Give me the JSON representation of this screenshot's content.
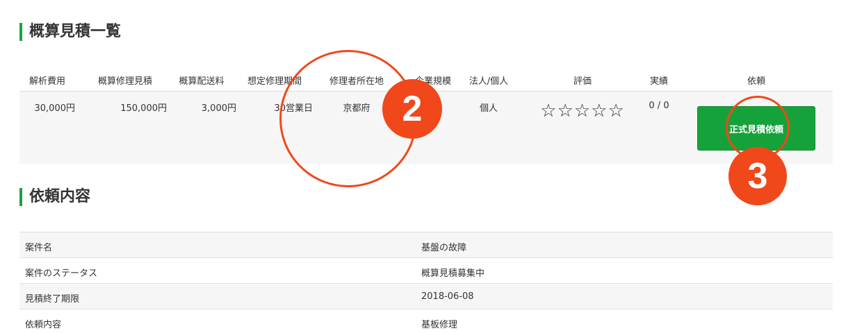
{
  "estimate_section": {
    "title": "概算見積一覧",
    "headers": [
      "解析費用",
      "概算修理見積",
      "概算配送料",
      "想定修理期間",
      "修理者所在地",
      "企業規模",
      "法人/個人",
      "評価",
      "実績",
      "依頼"
    ],
    "row": {
      "analysis_fee": "30,000円",
      "repair_estimate": "150,000円",
      "shipping_fee": "3,000円",
      "repair_period": "30営業日",
      "location": "京都府",
      "company_size": "",
      "entity_type": "個人",
      "rating_stars": "☆☆☆☆☆",
      "rating_value": 0,
      "rating_max": 5,
      "record": "0 / 0",
      "order_button_label": "正式見積依頼"
    }
  },
  "request_section": {
    "title": "依頼内容",
    "rows": [
      {
        "label": "案件名",
        "value": "基盤の故障"
      },
      {
        "label": "案件のステータス",
        "value": "概算見積募集中"
      },
      {
        "label": "見積終了期限",
        "value": "2018-06-08"
      },
      {
        "label": "依頼内容",
        "value": "基板修理"
      }
    ]
  },
  "annotations": {
    "badge_2": "2",
    "badge_3": "3",
    "color": "#f0481a"
  },
  "colors": {
    "accent_green": "#1aa33d",
    "button_green": "#16a23a",
    "row_gray": "#f6f6f6"
  }
}
